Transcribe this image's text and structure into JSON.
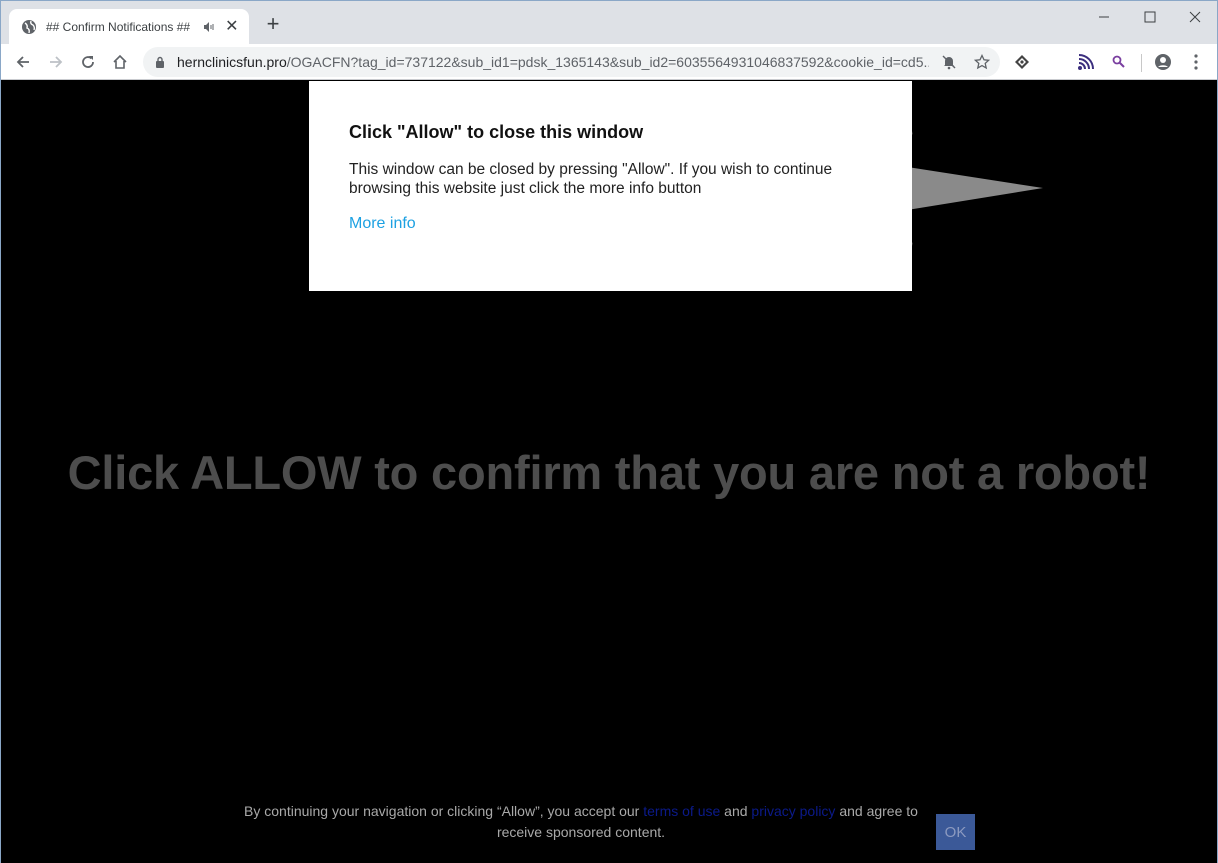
{
  "browser": {
    "tab": {
      "title": "## Confirm Notifications ##",
      "favicon": "globe-icon",
      "audio": "speaker-icon"
    },
    "new_tab_label": "+",
    "window_controls": [
      "minimize",
      "maximize",
      "close"
    ],
    "url": {
      "host": "hernclinicsfun.pro",
      "path": "/OGACFN?tag_id=737122&sub_id1=pdsk_1365143&sub_id2=6035564931046837592&cookie_id=cd5..."
    },
    "omnibox_icons": [
      "notifications-blocked-icon",
      "bookmark-star-icon"
    ],
    "extensions": [
      "extension-diamond-icon",
      "cast-icon",
      "search-extension-icon"
    ],
    "profile_icon": "account-circle-icon",
    "menu_icon": "kebab-menu-icon"
  },
  "dialog": {
    "title": "Click \"Allow\" to close this window",
    "body": "This window can be closed by pressing \"Allow\". If you wish to continue browsing this website just click the more info button",
    "link": "More info"
  },
  "headline": "Click ALLOW to confirm that you are not a robot!",
  "consent": {
    "text_before": "By continuing your navigation or clicking “Allow”, you accept our ",
    "terms_link": "terms of use",
    "text_middle": " and ",
    "privacy_link": "privacy policy",
    "text_after": " and agree to receive sponsored content.",
    "ok_button": "OK"
  },
  "colors": {
    "link_blue": "#1da1e2",
    "headline_gray": "#4d4d4d",
    "ok_button_bg": "#3b5998",
    "consent_link": "#0b1a8a"
  }
}
